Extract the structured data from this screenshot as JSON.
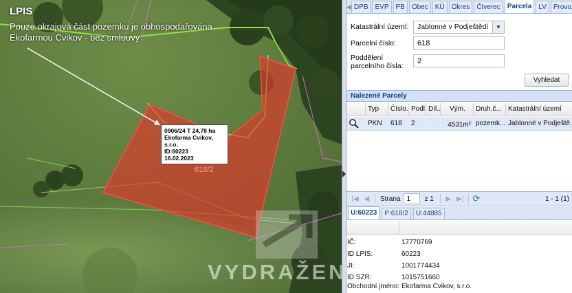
{
  "map": {
    "title": "LPIS",
    "note": "Pouze okrajová část pozemku je obhospodařována Ekofarmou Cvikov - bez smlouvy",
    "info_box": [
      "0906/24 T 24,78 ha",
      "Ekofarma Cvikov, s.r.o.",
      "ID:60223",
      "16.02.2023"
    ],
    "parcel_label": "618/2",
    "watermark": "VYDRAŽENO"
  },
  "tabs": [
    "DPB",
    "EVP",
    "PB",
    "Obec",
    "KÚ",
    "Okres",
    "Čtverec",
    "Parcela",
    "LV",
    "Provozovna"
  ],
  "active_tab": "Parcela",
  "form": {
    "ku_label": "Katastrální území:",
    "ku_value": "Jablonné v Podještědí",
    "parcel_label": "Parcelní číslo:",
    "parcel_value": "618",
    "sub_label_1": "Poddělení",
    "sub_label_2": "parcelního čísla:",
    "sub_value": "2",
    "search_label": "Vyhledat"
  },
  "results": {
    "title": "Nalezené Parcely",
    "columns": [
      "Typ",
      "Číslo...",
      "Podl...",
      "Díl...",
      "Vým.",
      "Druh.č...",
      "Katastrální území"
    ],
    "rows": [
      {
        "typ": "PKN",
        "cislo": "618",
        "podl": "2",
        "dil": "",
        "vym": "4531m²",
        "druh": "pozemk...",
        "ku": "Jablonné v Podještě..."
      }
    ]
  },
  "pager": {
    "page_label": "Strana",
    "page": "1",
    "of": "z 1",
    "range": "1 - 1 (1)"
  },
  "subtabs": [
    "U:60223",
    "P:618/2",
    "U:44885"
  ],
  "details": [
    {
      "k": "IČ:",
      "v": "17770769"
    },
    {
      "k": "ID LPIS:",
      "v": "60223"
    },
    {
      "k": "JI:",
      "v": "1001774434"
    },
    {
      "k": "ID SZR:",
      "v": "1015751660"
    },
    {
      "k": "Obchodní jméno:",
      "v": "Ekofarma Cvikov, s.r.o."
    }
  ],
  "colors": {
    "accent": "#15428b",
    "parcel_fill": "#e8322a",
    "lpis_line": "#7fe03d"
  }
}
